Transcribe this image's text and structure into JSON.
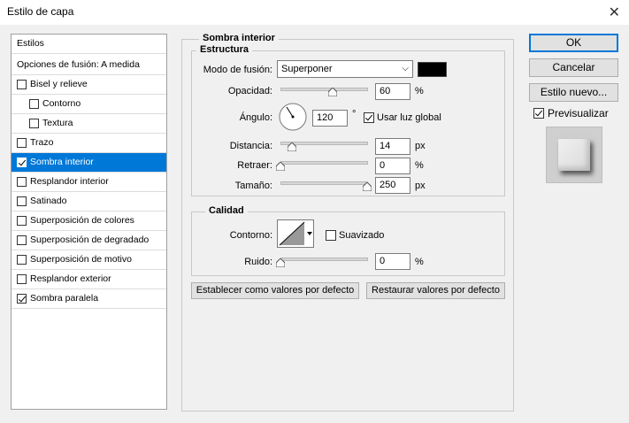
{
  "window": {
    "title": "Estilo de capa"
  },
  "style_list": {
    "header": "Estilos",
    "blending_options": "Opciones de fusión: A medida",
    "items": [
      {
        "label": "Bisel y relieve",
        "checked": false,
        "indent": false
      },
      {
        "label": "Contorno",
        "checked": false,
        "indent": true
      },
      {
        "label": "Textura",
        "checked": false,
        "indent": true
      },
      {
        "label": "Trazo",
        "checked": false,
        "indent": false
      },
      {
        "label": "Sombra interior",
        "checked": true,
        "indent": false,
        "selected": true
      },
      {
        "label": "Resplandor interior",
        "checked": false,
        "indent": false
      },
      {
        "label": "Satinado",
        "checked": false,
        "indent": false
      },
      {
        "label": "Superposición de colores",
        "checked": false,
        "indent": false
      },
      {
        "label": "Superposición de degradado",
        "checked": false,
        "indent": false
      },
      {
        "label": "Superposición de motivo",
        "checked": false,
        "indent": false
      },
      {
        "label": "Resplandor exterior",
        "checked": false,
        "indent": false
      },
      {
        "label": "Sombra paralela",
        "checked": true,
        "indent": false
      }
    ]
  },
  "panel": {
    "title": "Sombra interior",
    "structure": {
      "title": "Estructura",
      "blend_mode_label": "Modo de fusión:",
      "blend_mode_value": "Superponer",
      "shadow_color": "#000000",
      "opacity_label": "Opacidad:",
      "opacity_value": "60",
      "opacity_fraction": 0.6,
      "percent": "%",
      "angle_label": "Ángulo:",
      "angle_value": "120",
      "degree": "°",
      "global_light_label": "Usar luz global",
      "global_light_checked": true,
      "distance_label": "Distancia:",
      "distance_value": "14",
      "px": "px",
      "choke_label": "Retraer:",
      "choke_value": "0",
      "size_label": "Tamaño:",
      "size_value": "250"
    },
    "quality": {
      "title": "Calidad",
      "contour_label": "Contorno:",
      "antialias_label": "Suavizado",
      "antialias_checked": false,
      "noise_label": "Ruido:",
      "noise_value": "0"
    },
    "make_default": "Establecer como valores por defecto",
    "reset_default": "Restaurar valores por defecto"
  },
  "buttons": {
    "ok": "OK",
    "cancel": "Cancelar",
    "new_style": "Estilo nuevo...",
    "preview_label": "Previsualizar",
    "preview_checked": true
  },
  "accent_color": "#0078d7"
}
